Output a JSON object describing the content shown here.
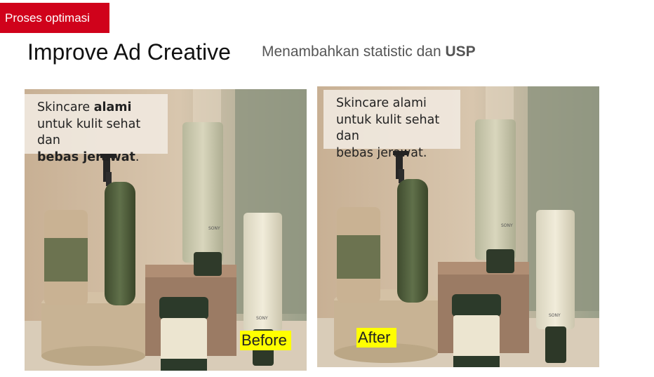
{
  "header": {
    "tag": "Proses optimasi",
    "title": "Improve Ad Creative",
    "subtitle_text": "Menambahkan statistic dan ",
    "subtitle_bold": "USP"
  },
  "before": {
    "caption_1": "Skincare ",
    "caption_bold_1": "alami",
    "caption_2": "untuk kulit sehat dan",
    "caption_bold_2": "bebas jerawat",
    "caption_3": ".",
    "label": "Before"
  },
  "after": {
    "caption_line1": "Skincare alami",
    "caption_line2": "untuk kulit sehat dan",
    "caption_line3": "bebas jerawat.",
    "label": "After"
  },
  "product_brand": "SONY",
  "colors": {
    "tag_bg": "#d0021b",
    "label_bg": "#ffff00",
    "bottle_green": "#56643f",
    "cream": "#ece6d6"
  }
}
